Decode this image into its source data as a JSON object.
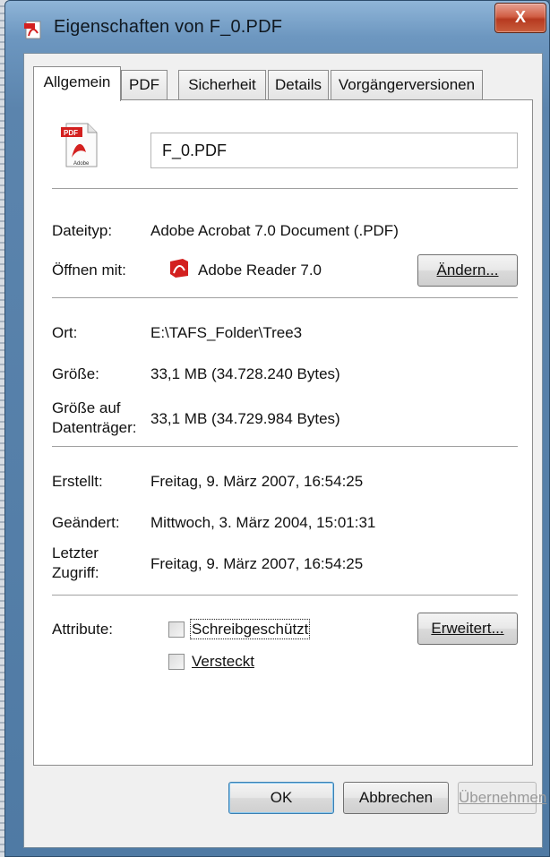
{
  "window": {
    "title": "Eigenschaften von F_0.PDF",
    "close_label": "X"
  },
  "tabs": [
    {
      "label": "Allgemein",
      "active": true
    },
    {
      "label": "PDF",
      "active": false
    },
    {
      "label": "Sicherheit",
      "active": false
    },
    {
      "label": "Details",
      "active": false
    },
    {
      "label": "Vorgängerversionen",
      "active": false
    }
  ],
  "file": {
    "name": "F_0.PDF",
    "icon": "pdf-file-icon"
  },
  "info": {
    "type_label": "Dateityp:",
    "type_value": "Adobe Acrobat 7.0 Document (.PDF)",
    "open_with_label": "Öffnen mit:",
    "open_with_value": "Adobe Reader 7.0",
    "change_button": "Ändern...",
    "location_label": "Ort:",
    "location_value": "E:\\TAFS_Folder\\Tree3",
    "size_label": "Größe:",
    "size_value": "33,1 MB (34.728.240 Bytes)",
    "disk_size_label_line1": "Größe auf",
    "disk_size_label_line2": "Datenträger:",
    "disk_size_value": "33,1 MB (34.729.984 Bytes)",
    "created_label": "Erstellt:",
    "created_value": "Freitag, 9. März 2007, 16:54:25",
    "modified_label": "Geändert:",
    "modified_value": "Mittwoch, 3. März 2004, 15:01:31",
    "accessed_label_line1": "Letzter",
    "accessed_label_line2": "Zugriff:",
    "accessed_value": "Freitag, 9. März 2007, 16:54:25"
  },
  "attributes": {
    "label": "Attribute:",
    "readonly_label": "Schreibgeschützt",
    "readonly_checked": false,
    "hidden_label": "Versteckt",
    "hidden_checked": false,
    "advanced_button": "Erweitert..."
  },
  "footer": {
    "ok": "OK",
    "cancel": "Abbrechen",
    "apply": "Übernehmen"
  },
  "colors": {
    "close_button": "#c9462b",
    "titlebar": "#6d97c0",
    "dialog_bg": "#f0f0f0",
    "pdf_red": "#d3201f"
  }
}
